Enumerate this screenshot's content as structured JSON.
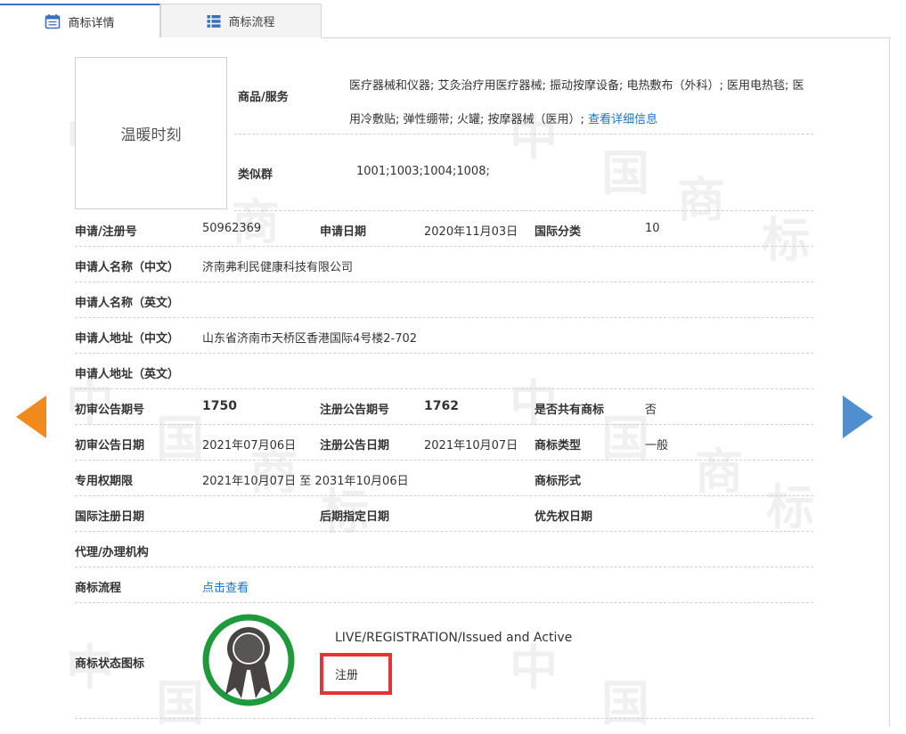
{
  "tabs": [
    {
      "label": "商标详情",
      "icon": "calendar-icon"
    },
    {
      "label": "商标流程",
      "icon": "list-icon"
    }
  ],
  "trademark_image_text": "温暖时刻",
  "goods_services": {
    "label": "商品/服务",
    "items_text": "医疗器械和仪器; 艾灸治疗用医疗器械; 振动按摩设备; 电热敷布（外科）; 医用电热毯; 医用冷敷贴; 弹性绷带; 火罐; 按摩器械（医用）;",
    "detail_link": "查看详细信息"
  },
  "similar_group": {
    "label": "类似群",
    "value": "1001;1003;1004;1008;"
  },
  "fields": {
    "reg_no": {
      "label": "申请/注册号",
      "value": "50962369"
    },
    "apply_date": {
      "label": "申请日期",
      "value": "2020年11月03日"
    },
    "intl_class": {
      "label": "国际分类",
      "value": "10"
    },
    "applicant_cn": {
      "label": "申请人名称（中文）",
      "value": "济南弗利民健康科技有限公司"
    },
    "applicant_en": {
      "label": "申请人名称（英文）",
      "value": ""
    },
    "address_cn": {
      "label": "申请人地址（中文）",
      "value": "山东省济南市天桥区香港国际4号楼2-702"
    },
    "address_en": {
      "label": "申请人地址（英文）",
      "value": ""
    },
    "prelim_issue": {
      "label": "初审公告期号",
      "value": "1750"
    },
    "reg_issue": {
      "label": "注册公告期号",
      "value": "1762"
    },
    "shared": {
      "label": "是否共有商标",
      "value": "否"
    },
    "prelim_date": {
      "label": "初审公告日期",
      "value": "2021年07月06日"
    },
    "reg_date": {
      "label": "注册公告日期",
      "value": "2021年10月07日"
    },
    "tm_type": {
      "label": "商标类型",
      "value": "一般"
    },
    "exclusive_period": {
      "label": "专用权期限",
      "value": "2021年10月07日 至 2031年10月06日"
    },
    "tm_form": {
      "label": "商标形式",
      "value": ""
    },
    "intl_reg_date": {
      "label": "国际注册日期",
      "value": ""
    },
    "later_date": {
      "label": "后期指定日期",
      "value": ""
    },
    "priority_date": {
      "label": "优先权日期",
      "value": ""
    },
    "agent": {
      "label": "代理/办理机构",
      "value": ""
    },
    "process": {
      "label": "商标流程",
      "link": "点击查看"
    },
    "status_icon": {
      "label": "商标状态图标"
    }
  },
  "status": {
    "english": "LIVE/REGISTRATION/Issued and Active",
    "chinese": "注册",
    "icon": "award-ribbon-icon",
    "ring_color": "#1e9a3c",
    "box_color": "#e63434"
  },
  "watermark_chars": [
    "中",
    "国",
    "商",
    "标"
  ],
  "colors": {
    "accent": "#3a70c2",
    "link": "#1a73c8",
    "prev_arrow": "#f08a1c",
    "next_arrow": "#4f8fd0"
  },
  "nav": {
    "prev_icon": "arrow-left-icon",
    "next_icon": "arrow-right-icon"
  }
}
